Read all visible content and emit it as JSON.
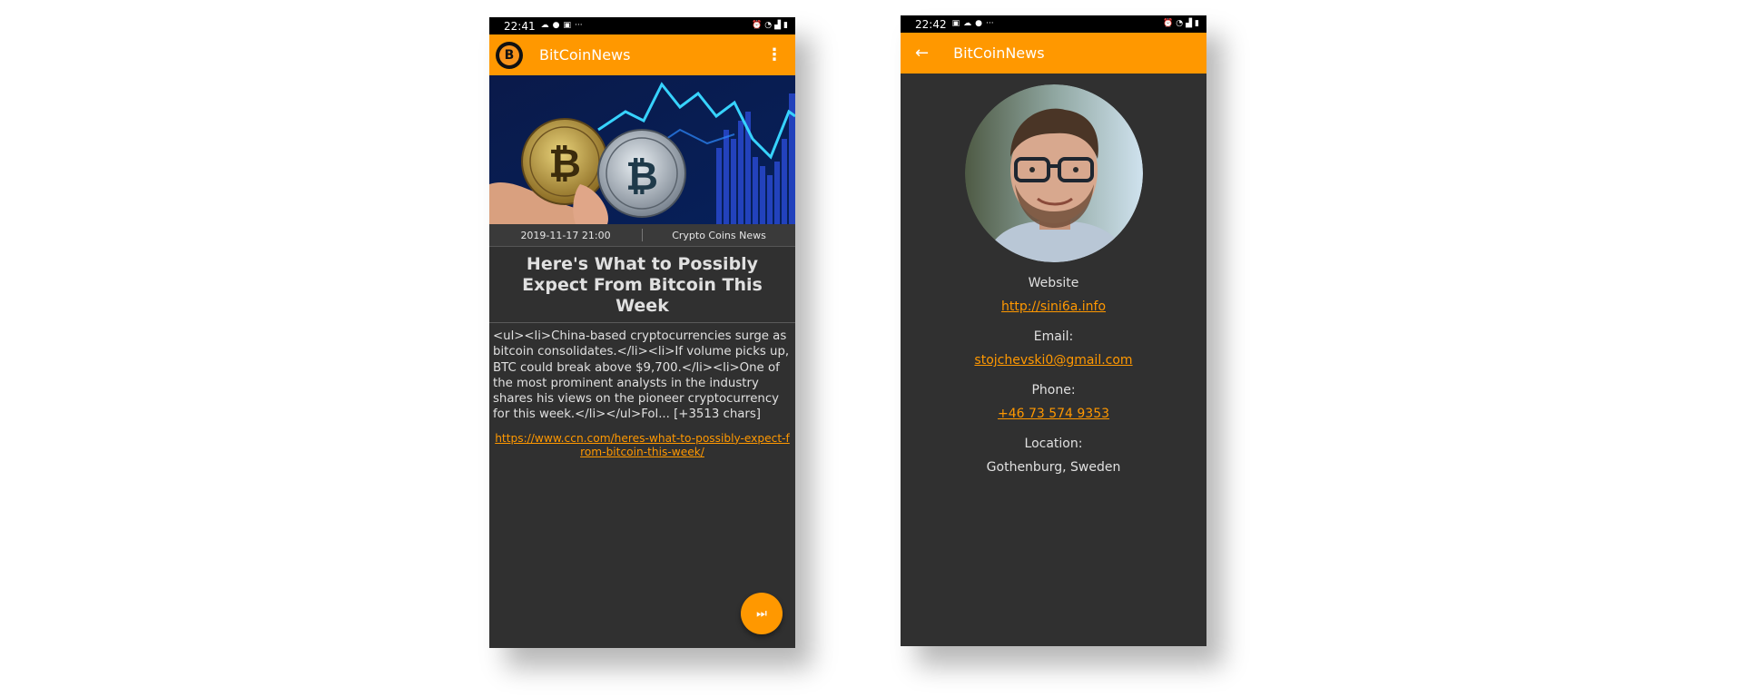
{
  "colors": {
    "accent": "#ff9800",
    "background": "#303030",
    "statusbar": "#000000",
    "text": "#e0e0e0"
  },
  "left_phone": {
    "status": {
      "time": "22:41",
      "more": "···"
    },
    "appbar": {
      "title": "BitCoinNews",
      "logo_letter": "B",
      "overflow_icon": "more-vert-icon"
    },
    "article": {
      "date": "2019-11-17 21:00",
      "source": "Crypto Coins News",
      "title": "Here's What to Possibly Expect From Bitcoin This Week",
      "body": "<ul><li>China-based cryptocurrencies surge as bitcoin consolidates.</li><li>If volume picks up, BTC could break above $9,700.</li><li>One of the most prominent analysts in the industry shares his views on the pioneer cryptocurrency for this week.</li></ul>Fol... [+3513 chars]",
      "url": "https://www.ccn.com/heres-what-to-possibly-expect-from-bitcoin-this-week/"
    },
    "fab_icon": "skip-next-icon"
  },
  "right_phone": {
    "status": {
      "time": "22:42",
      "more": "···"
    },
    "appbar": {
      "title": "BitCoinNews",
      "back_icon": "arrow-back-icon"
    },
    "profile": {
      "website_label": "Website",
      "website": "http://sini6a.info",
      "email_label": "Email:",
      "email": "stojchevski0@gmail.com",
      "phone_label": "Phone:",
      "phone": "+46 73 574 9353",
      "location_label": "Location:",
      "location": "Gothenburg, Sweden"
    }
  }
}
